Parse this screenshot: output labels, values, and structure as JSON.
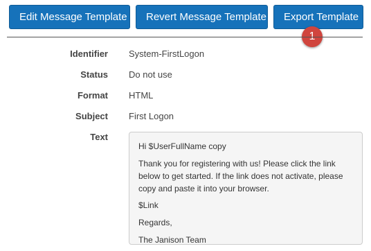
{
  "toolbar": {
    "edit_label": "Edit Message Template",
    "revert_label": "Revert Message Template",
    "export_label": "Export Template"
  },
  "badge": {
    "number": "1"
  },
  "details": {
    "identifier": {
      "label": "Identifier",
      "value": "System-FirstLogon"
    },
    "status": {
      "label": "Status",
      "value": "Do not use"
    },
    "format": {
      "label": "Format",
      "value": "HTML"
    },
    "subject": {
      "label": "Subject",
      "value": "First Logon"
    },
    "text": {
      "label": "Text"
    }
  },
  "message": {
    "greeting": "Hi $UserFullName copy",
    "body": "Thank you for registering with us!  Please click the link below to get started. If the link does not activate, please copy and paste it into your browser.",
    "link": "$Link",
    "closing": "Regards,",
    "signature": "The Janison Team"
  },
  "colors": {
    "button": "#1672ba",
    "badge": "#d0453e",
    "text_box_bg": "#f5f5f5"
  }
}
